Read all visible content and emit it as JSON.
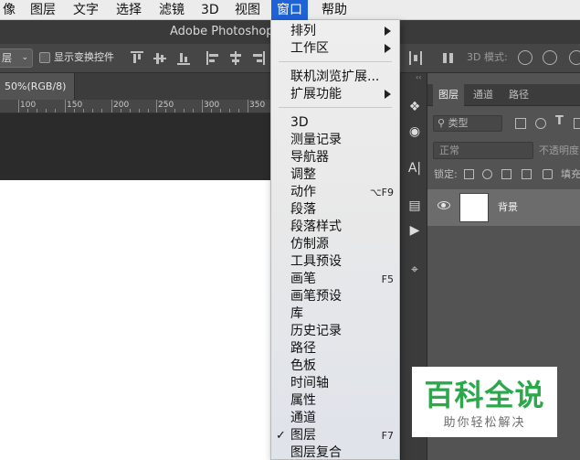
{
  "menubar": {
    "items": [
      "像",
      "图层",
      "文字",
      "选择",
      "滤镜",
      "3D",
      "视图",
      "窗口",
      "帮助"
    ],
    "active": "窗口"
  },
  "app": {
    "title": "Adobe Photoshop"
  },
  "options_bar": {
    "layer_select": "层",
    "show_transform_controls": "显示变换控件",
    "mode_3d": "3D 模式:"
  },
  "document": {
    "tab_label": "50%(RGB/8)"
  },
  "ruler": {
    "ticks": [
      "100",
      "150",
      "200",
      "250",
      "300",
      "350"
    ]
  },
  "window_menu": {
    "items": [
      {
        "label": "排列",
        "submenu": true
      },
      {
        "label": "工作区",
        "submenu": true
      },
      {
        "label": "联机浏览扩展..."
      },
      {
        "label": "扩展功能",
        "submenu": true
      },
      {
        "label": "3D"
      },
      {
        "label": "测量记录"
      },
      {
        "label": "导航器"
      },
      {
        "label": "调整"
      },
      {
        "label": "动作",
        "shortcut": "⌥F9"
      },
      {
        "label": "段落"
      },
      {
        "label": "段落样式"
      },
      {
        "label": "仿制源"
      },
      {
        "label": "工具预设"
      },
      {
        "label": "画笔",
        "shortcut": "F5"
      },
      {
        "label": "画笔预设"
      },
      {
        "label": "库"
      },
      {
        "label": "历史记录"
      },
      {
        "label": "路径"
      },
      {
        "label": "色板"
      },
      {
        "label": "时间轴"
      },
      {
        "label": "属性"
      },
      {
        "label": "通道"
      },
      {
        "label": "图层",
        "shortcut": "F7",
        "checked": true
      },
      {
        "label": "图层复合"
      }
    ],
    "check_mark": "✓"
  },
  "layers_panel": {
    "tabs": [
      "图层",
      "通道",
      "路径"
    ],
    "active_tab": "图层",
    "kind_filter": "类型",
    "blend_mode": "正常",
    "opacity_label": "不透明度",
    "lock_label": "锁定:",
    "fill_label": "填充",
    "layers": [
      {
        "name": "背景"
      }
    ]
  },
  "watermark": {
    "title": "百科全说",
    "subtitle": "助你轻松解决"
  },
  "colors": {
    "menu_highlight": "#1d62d6",
    "watermark_green": "#2aa84a"
  }
}
